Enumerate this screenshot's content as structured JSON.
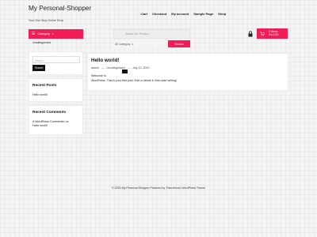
{
  "site": {
    "title": "My Personal-Shopper",
    "tagline": "Your One Stop Online Shop"
  },
  "nav": {
    "items": [
      "Cart",
      "Checkout",
      "My account",
      "Sample Page",
      "Shop"
    ]
  },
  "category_menu": {
    "label": "Category",
    "icon": "menu-icon"
  },
  "search": {
    "placeholder": "Search for Product",
    "category_select": "All Category",
    "button_label": "Search"
  },
  "cart": {
    "line1": "0 items",
    "line2": "Rs 0.00",
    "icon": "cart-icon"
  },
  "sidebar": {
    "category_item": "Uncategorized",
    "search_placeholder": "Search",
    "search_button": "Search",
    "recent_posts": {
      "title": "Recent Posts",
      "items": [
        "Hello world!"
      ]
    },
    "recent_comments": {
      "title": "Recent Comments",
      "items": [
        "A WordPress Commenter on",
        "Hello world!"
      ]
    }
  },
  "post": {
    "title": "Hello world!",
    "author": "admin",
    "category": "Uncategorized",
    "date": "July 12, 2020",
    "sep": "—",
    "body_line1": "Welcome to",
    "body_line2": "WordPress. This is your first post. Edit or delete it, then start writing!"
  },
  "footer": {
    "text": "© 2020 My Personal-Shopper Powered by Themehunk WordPress Theme"
  },
  "colors": {
    "accent": "#f01d56",
    "dark": "#111111"
  }
}
